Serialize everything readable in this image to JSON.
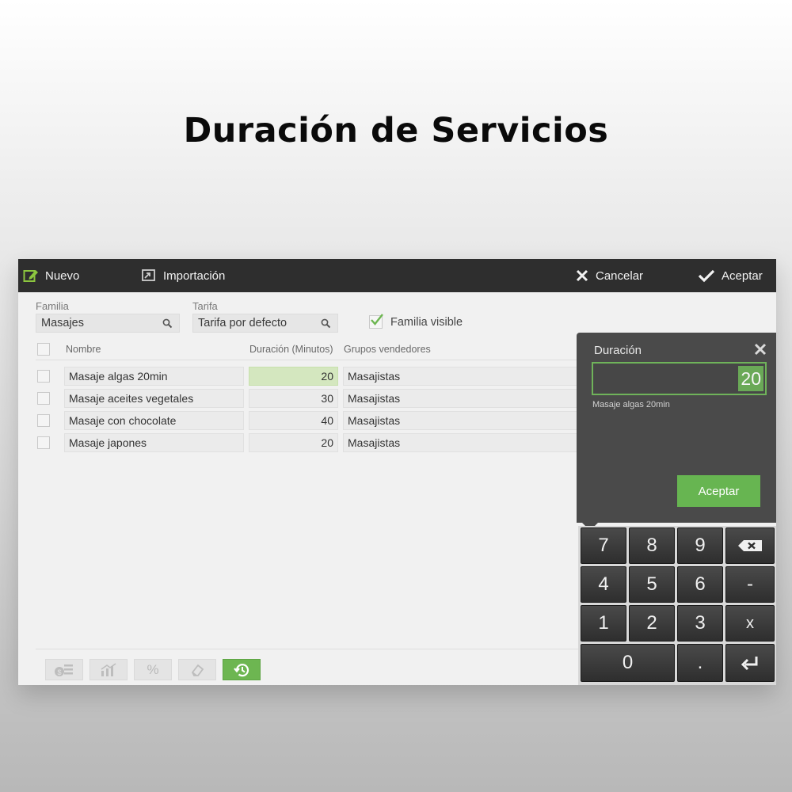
{
  "page_title": "Duración de Servicios",
  "toolbar": {
    "nuevo": "Nuevo",
    "importacion": "Importación",
    "cancelar": "Cancelar",
    "aceptar": "Aceptar"
  },
  "filters": {
    "familia_label": "Familia",
    "familia_value": "Masajes",
    "tarifa_label": "Tarifa",
    "tarifa_value": "Tarifa por defecto",
    "familia_visible_label": "Familia visible",
    "familia_visible_checked": true
  },
  "table": {
    "headers": {
      "nombre": "Nombre",
      "duracion": "Duración (Minutos)",
      "grupos": "Grupos vendedores"
    },
    "rows": [
      {
        "nombre": "Masaje algas 20min",
        "duracion": "20",
        "grupo": "Masajistas"
      },
      {
        "nombre": "Masaje aceites vegetales",
        "duracion": "30",
        "grupo": "Masajistas"
      },
      {
        "nombre": "Masaje con chocolate",
        "duracion": "40",
        "grupo": "Masajistas"
      },
      {
        "nombre": "Masaje japones",
        "duracion": "20",
        "grupo": "Masajistas"
      }
    ]
  },
  "bottom_buttons": [
    "price-list-icon",
    "chart-icon",
    "percent-icon",
    "eraser-icon",
    "history-icon"
  ],
  "bottom_percent": "%",
  "popup": {
    "title": "Duración",
    "value": "20",
    "subtitle": "Masaje algas 20min",
    "accept": "Aceptar"
  },
  "numpad": {
    "row1": [
      "7",
      "8",
      "9"
    ],
    "row2": [
      "4",
      "5",
      "6",
      "-"
    ],
    "row3": [
      "1",
      "2",
      "3",
      "x"
    ],
    "row4": [
      "0",
      "."
    ]
  },
  "colors": {
    "accent": "#6db651",
    "toolbar": "#2e2e2e",
    "popup": "#4a4a4a"
  }
}
